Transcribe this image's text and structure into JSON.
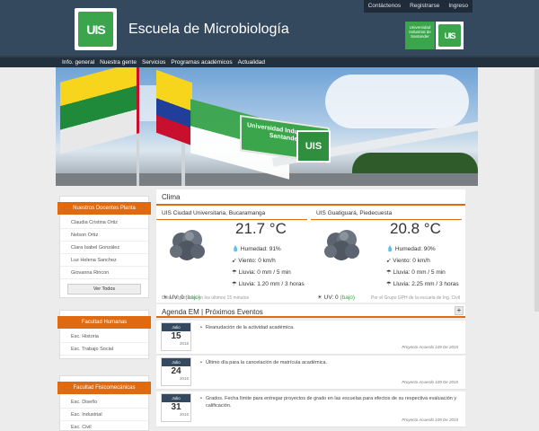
{
  "header": {
    "top_links": [
      "Contáctenos",
      "Registrarse",
      "Ingreso"
    ],
    "title": "Escuela de Microbiología",
    "logo_text": "UIS",
    "badge_text": "Universidad Industrial de Santander",
    "logo2_text": "UIS"
  },
  "nav": {
    "items": [
      "Info. general",
      "Nuestra gente",
      "Servicios",
      "Programas académicos",
      "Actualidad"
    ]
  },
  "banner": {
    "sign_text": "Universidad Industrial de Santander",
    "sign2_text": "UIS"
  },
  "sidebar": {
    "docentes": {
      "title": "Nuestros Docentes Planta",
      "items": [
        "Claudia Cristina Ortiz",
        "Nelson Ortiz",
        "Clara Isabel González",
        "Luz Helena Sanchez",
        "Giovanna Rincon"
      ],
      "button": "Ver Todos"
    },
    "humanas": {
      "title": "Facultad Humanas",
      "items": [
        "Esc. Historia",
        "Esc. Trabajo Social"
      ]
    },
    "fisico": {
      "title": "Facultad Fisicomecánicas",
      "items": [
        "Esc. Diseño",
        "Esc. Industrial",
        "Esc. Civil"
      ]
    }
  },
  "clima": {
    "title": "Clima",
    "stations": [
      {
        "place": "UIS Ciudad Universitaria, Bucaramanga",
        "temp": "21.7 °C",
        "humedad": "Humedad: 91%",
        "viento": "Viento: 0 km/h",
        "lluvia": "Lluvia: 0 mm / 5 min",
        "lluvia3": "Lluvia: 1.20 mm / 3 horas",
        "uv": "UV: 0",
        "uv_level": "(bajo)"
      },
      {
        "place": "UIS Guatiguará, Piedecuesta",
        "temp": "20.8 °C",
        "humedad": "Humedad: 90%",
        "viento": "Viento: 0 km/h",
        "lluvia": "Lluvia: 0 mm / 5 min",
        "lluvia3": "Lluvia: 2.25 mm / 3 horas",
        "uv": "UV: 0",
        "uv_level": "(bajo)"
      }
    ],
    "footer_left": "Datos registrados en los últimos 15 minutos",
    "footer_right": "Por el Grupo GPH de la escuela de Ing. Civil"
  },
  "agenda": {
    "title": "Agenda EM | Próximos Eventos",
    "plus": "+",
    "events": [
      {
        "month": "Julio",
        "day": "15",
        "year": "2015",
        "text": "Reanudación de la actividad académica.",
        "note": "Proyecto Acuerdo 109 De 2015"
      },
      {
        "month": "Julio",
        "day": "24",
        "year": "2015",
        "text": "Último día para la cancelación de matrícula académica.",
        "note": "Proyecto Acuerdo 109 De 2015"
      },
      {
        "month": "Julio",
        "day": "31",
        "year": "2015",
        "text": "Grados. Fecha límite para entregar proyectos de grado en las escuelas para efectos de su respectiva evaluación y calificación.",
        "note": "Proyecto Acuerdo 109 De 2015"
      }
    ]
  }
}
